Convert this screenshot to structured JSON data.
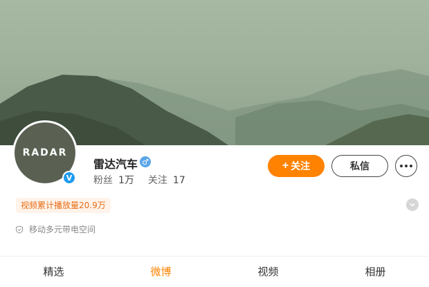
{
  "profile": {
    "avatar_logo_text": "RADAR",
    "name": "雷达汽车",
    "gender_icon": "male-icon",
    "fans_label": "粉丝",
    "fans_value": "1万",
    "following_label": "关注",
    "following_value": "17",
    "play_count_badge": "视频累计播放量20.9万",
    "location_text": "移动多元带电空间"
  },
  "actions": {
    "follow_label": "关注",
    "message_label": "私信"
  },
  "tabs": [
    {
      "label": "精选",
      "active": false
    },
    {
      "label": "微博",
      "active": true
    },
    {
      "label": "视频",
      "active": false
    },
    {
      "label": "相册",
      "active": false
    }
  ],
  "colors": {
    "accent": "#ff8200",
    "banner": "#9fb19b",
    "badge_text": "#e86c14"
  }
}
